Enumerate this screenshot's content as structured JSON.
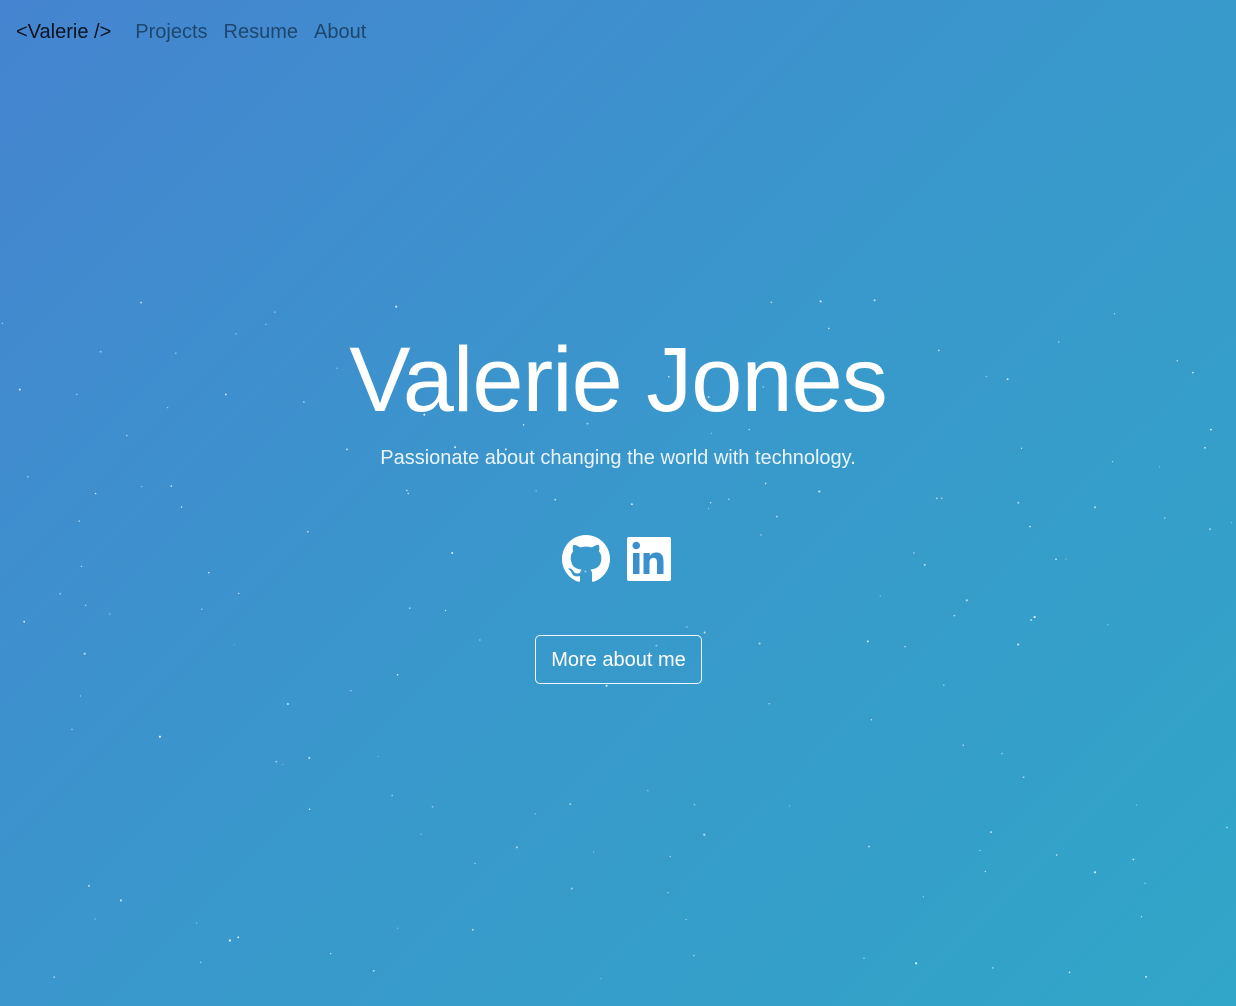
{
  "nav": {
    "brand": "<Valerie />",
    "links": [
      "Projects",
      "Resume",
      "About"
    ]
  },
  "hero": {
    "name": "Valerie Jones",
    "tagline": "Passionate about changing the world with technology.",
    "cta_label": "More about me"
  },
  "socials": [
    {
      "icon": "github-icon"
    },
    {
      "icon": "linkedin-icon"
    }
  ],
  "colors": {
    "gradient_start": "#4584d0",
    "gradient_end": "#31a6c8",
    "text_primary": "#ffffff",
    "nav_brand": "#0b1320",
    "nav_link": "#173b5e"
  }
}
